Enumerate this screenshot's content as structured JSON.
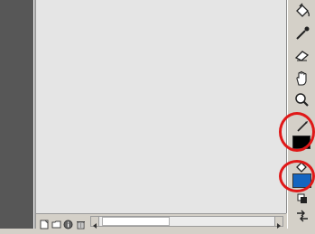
{
  "tools": [
    {
      "name": "paint-bucket-icon"
    },
    {
      "name": "eyedropper-icon"
    },
    {
      "name": "eraser-icon"
    },
    {
      "name": "hand-icon"
    },
    {
      "name": "zoom-icon"
    },
    {
      "name": "pencil-stroke-icon"
    },
    {
      "name": "fill-color-icon"
    },
    {
      "name": "default-colors-icon"
    },
    {
      "name": "swap-colors-icon"
    }
  ],
  "colors": {
    "stroke_color": "#000000",
    "fill_color": "#1565c0",
    "highlight": "#e01818"
  },
  "bottom_icons": [
    "new-layer-icon",
    "folder-icon",
    "info-icon",
    "trash-icon"
  ]
}
